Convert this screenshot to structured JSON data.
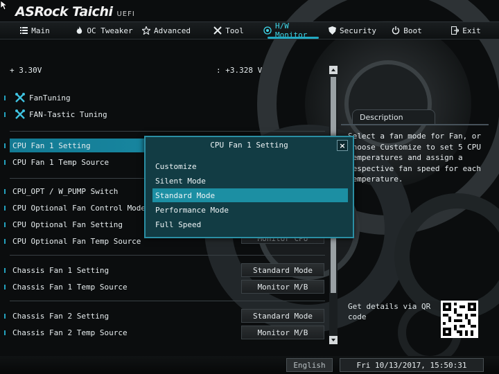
{
  "brand": {
    "name": "ASRock Taichi",
    "tag": "UEFI"
  },
  "menu": [
    {
      "label": "Main",
      "icon": "list-icon",
      "active": false
    },
    {
      "label": "OC Tweaker",
      "icon": "flame-icon",
      "active": false
    },
    {
      "label": "Advanced",
      "icon": "star-icon",
      "active": false
    },
    {
      "label": "Tool",
      "icon": "tools-icon",
      "active": false
    },
    {
      "label": "H/W Monitor",
      "icon": "monitor-icon",
      "active": true
    },
    {
      "label": "Security",
      "icon": "shield-icon",
      "active": false
    },
    {
      "label": "Boot",
      "icon": "power-icon",
      "active": false
    },
    {
      "label": "Exit",
      "icon": "exit-icon",
      "active": false
    }
  ],
  "voltage": {
    "label": "+ 3.30V",
    "value": ": +3.328 V"
  },
  "tools": [
    {
      "label": "FanTuning",
      "icon": "wrench-icon"
    },
    {
      "label": "FAN-Tastic Tuning",
      "icon": "wrench-icon"
    }
  ],
  "settings": [
    {
      "label": "CPU Fan 1 Setting",
      "value": "Standard Mode",
      "selected": true
    },
    {
      "label": "CPU Fan 1 Temp Source",
      "value": ""
    },
    {
      "label": "CPU_OPT / W_PUMP Switch",
      "value": ""
    },
    {
      "label": "CPU Optional Fan Control Mode",
      "value": ""
    },
    {
      "label": "CPU Optional Fan Setting",
      "value": ""
    },
    {
      "label": "CPU Optional Fan Temp Source",
      "value": "Monitor CPU"
    },
    {
      "label": "Chassis Fan 1 Setting",
      "value": "Standard Mode"
    },
    {
      "label": "Chassis Fan 1 Temp Source",
      "value": "Monitor M/B"
    },
    {
      "label": "Chassis Fan 2 Setting",
      "value": "Standard Mode"
    },
    {
      "label": "Chassis Fan 2 Temp Source",
      "value": "Monitor M/B"
    }
  ],
  "description": {
    "title": "Description",
    "text": "Select a fan mode for Fan, or choose Customize to set 5 CPU temperatures and assign a respective fan speed for each temperature.",
    "qr_label": "Get details via QR code"
  },
  "modal": {
    "title": "CPU Fan 1 Setting",
    "close": "×",
    "options": [
      "Customize",
      "Silent Mode",
      "Standard Mode",
      "Performance Mode",
      "Full Speed"
    ],
    "selected": "Standard Mode"
  },
  "footer": {
    "language": "English",
    "datetime": "Fri 10/13/2017, 15:50:31"
  }
}
